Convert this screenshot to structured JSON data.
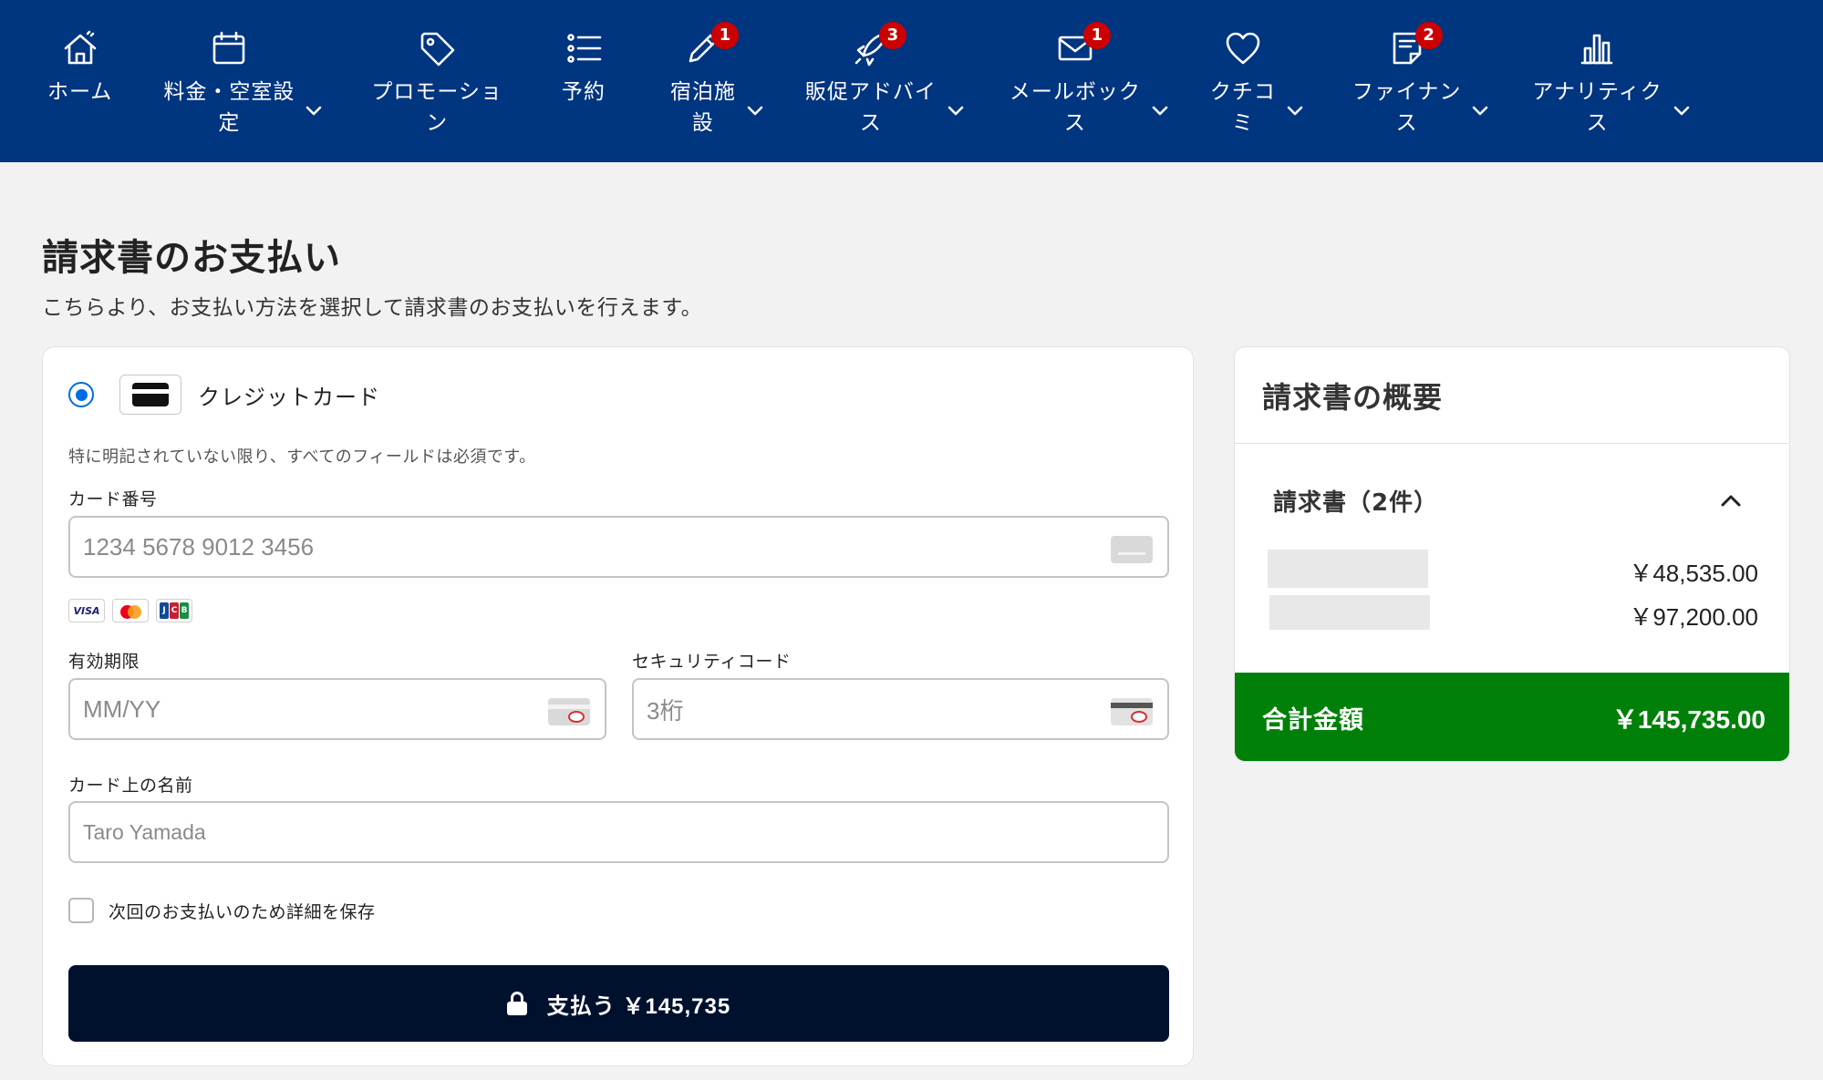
{
  "nav": {
    "items": [
      {
        "label": "ホーム",
        "icon": "home-icon",
        "has_chevron": false
      },
      {
        "label": "料金・空室設\n定",
        "icon": "calendar-icon",
        "has_chevron": true
      },
      {
        "label": "プロモーショ\nン",
        "icon": "tag-icon",
        "has_chevron": false
      },
      {
        "label": "予約",
        "icon": "list-icon",
        "has_chevron": false
      },
      {
        "label": "宿泊施\n設",
        "icon": "pencil-icon",
        "badge": "1",
        "has_chevron": true
      },
      {
        "label": "販促アドバイ\nス",
        "icon": "rocket-icon",
        "badge": "3",
        "has_chevron": true
      },
      {
        "label": "メールボック\nス",
        "icon": "mail-icon",
        "badge": "1",
        "has_chevron": true
      },
      {
        "label": "クチコ\nミ",
        "icon": "heart-icon",
        "has_chevron": true
      },
      {
        "label": "ファイナン\nス",
        "icon": "invoice-icon",
        "badge": "2",
        "has_chevron": true
      },
      {
        "label": "アナリティク\nス",
        "icon": "bar-chart-icon",
        "has_chevron": true
      }
    ]
  },
  "page": {
    "title": "請求書のお支払い",
    "subtitle": "こちらより、お支払い方法を選択して請求書のお支払いを行えます。"
  },
  "payment": {
    "method_label": "クレジットカード",
    "required_note": "特に明記されていない限り、すべてのフィールドは必須です。",
    "card_number_label": "カード番号",
    "card_number_placeholder": "1234 5678 9012 3456",
    "brands": {
      "visa": "VISA",
      "jcb": [
        "J",
        "C",
        "B"
      ]
    },
    "expiry_label": "有効期限",
    "expiry_placeholder": "MM/YY",
    "cvc_label": "セキュリティコード",
    "cvc_placeholder": "3桁",
    "name_label": "カード上の名前",
    "name_placeholder": "Taro Yamada",
    "save_details_label": "次回のお支払いのため詳細を保存",
    "pay_button_label": "支払う ￥145,735"
  },
  "summary": {
    "title": "請求書の概要",
    "invoices_heading": "請求書（2件）",
    "invoices": [
      {
        "amount": "￥48,535.00"
      },
      {
        "amount": "￥97,200.00"
      }
    ],
    "total_label": "合計金額",
    "total_value": "￥145,735.00"
  },
  "colors": {
    "nav_bg": "#003580",
    "badge": "#cc0000",
    "radio_accent": "#006ce4",
    "pay_button_bg": "#00112e",
    "total_bg": "#008009"
  }
}
